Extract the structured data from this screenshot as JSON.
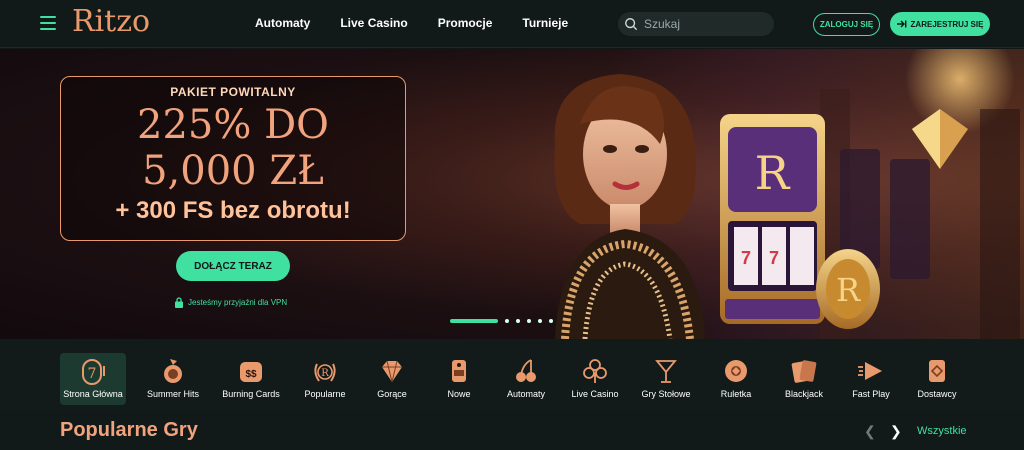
{
  "header": {
    "logo": "Ritzo",
    "nav": [
      "Automaty",
      "Live Casino",
      "Promocje",
      "Turnieje"
    ],
    "search_placeholder": "Szukaj",
    "login_label": "ZALOGUJ SIĘ",
    "register_label": "ZAREJESTRUJ SIĘ"
  },
  "hero": {
    "subtitle": "PAKIET POWITALNY",
    "line1": "225% DO",
    "line2": "5,000 ZŁ",
    "line3": "+ 300 FS bez obrotu!",
    "cta_label": "DOŁĄCZ TERAZ",
    "vpn_note": "Jesteśmy przyjaźni dla VPN",
    "slide_count": 6,
    "active_slide": 1,
    "slot_letter": "R"
  },
  "categories": [
    {
      "label": "Strona Główna",
      "icon": "slot-seven-icon",
      "active": true
    },
    {
      "label": "Summer Hits",
      "icon": "fruit-icon"
    },
    {
      "label": "Burning Cards",
      "icon": "dollar-cards-icon"
    },
    {
      "label": "Popularne",
      "icon": "laurel-r-icon"
    },
    {
      "label": "Gorące",
      "icon": "diamond-icon"
    },
    {
      "label": "Nowe",
      "icon": "new-tag-icon"
    },
    {
      "label": "Automaty",
      "icon": "cherries-icon"
    },
    {
      "label": "Live Casino",
      "icon": "clubs-icon"
    },
    {
      "label": "Gry Stołowe",
      "icon": "cocktail-icon"
    },
    {
      "label": "Ruletka",
      "icon": "roulette-icon"
    },
    {
      "label": "Blackjack",
      "icon": "cards-icon"
    },
    {
      "label": "Fast Play",
      "icon": "fast-play-icon"
    },
    {
      "label": "Dostawcy",
      "icon": "providers-icon"
    }
  ],
  "section": {
    "title": "Popularne Gry",
    "see_all": "Wszystkie"
  },
  "colors": {
    "accent": "#3fe0a0",
    "brand": "#e89a6c",
    "background": "#101716"
  }
}
